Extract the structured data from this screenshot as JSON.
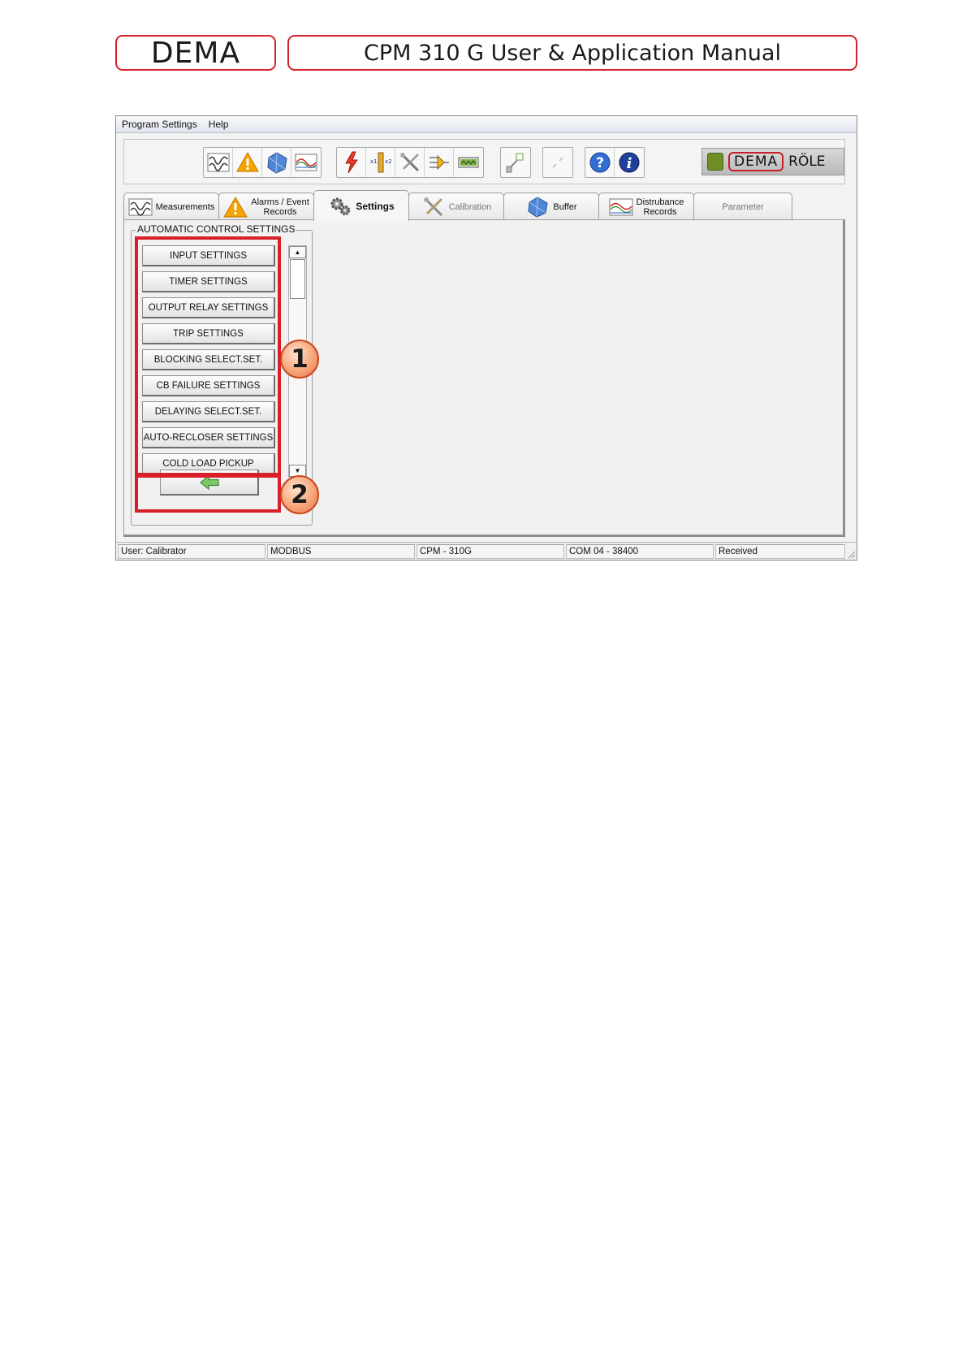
{
  "header": {
    "logo_text": "DEMA",
    "manual_title": "CPM 310 G User & Application Manual"
  },
  "menu": {
    "program_settings": "Program Settings",
    "help": "Help"
  },
  "toolbar": {
    "group1": [
      "measurements-icon",
      "alarm-warning-icon",
      "buffer-cube-icon",
      "disturbance-records-icon"
    ],
    "group2": [
      "trip-lightning-icon",
      "transformer-ratio-icon",
      "calibration-tools-icon",
      "logic-settings-icon",
      "parameter-display-icon"
    ],
    "group3": [
      "connect-plug-icon"
    ],
    "group4": [
      "disconnect-plug-icon"
    ],
    "group5": [
      "help-question-icon",
      "info-icon"
    ],
    "brand_dema": "DEMA",
    "brand_role": "RÖLE"
  },
  "tabs": {
    "measurements": "Measurements",
    "alarms_line1": "Alarms / Event",
    "alarms_line2": "Records",
    "settings": "Settings",
    "calibration": "Calibration",
    "buffer": "Buffer",
    "disturbance_line1": "Distrubance",
    "disturbance_line2": "Records",
    "parameter": "Parameter"
  },
  "settings_panel": {
    "group_title": "AUTOMATIC CONTROL SETTINGS",
    "buttons": [
      "INPUT SETTINGS",
      "TIMER SETTINGS",
      "OUTPUT RELAY SETTINGS",
      "TRIP SETTINGS",
      "BLOCKING SELECT.SET.",
      "CB FAILURE SETTINGS",
      "DELAYING SELECT.SET.",
      "AUTO-RECLOSER SETTINGS",
      "COLD LOAD PICKUP"
    ],
    "back_icon": "green-back-arrow-icon"
  },
  "statusbar": {
    "user": "User: Calibrator",
    "protocol": "MODBUS",
    "device": "CPM - 310G",
    "port": "COM 04 - 38400",
    "state": "Received"
  },
  "annotations": {
    "callout_1": "1",
    "callout_2": "2"
  },
  "colors": {
    "brand_red": "#d42128",
    "annotation_red": "#d9202a",
    "callout_fill": "#f7a57a"
  }
}
